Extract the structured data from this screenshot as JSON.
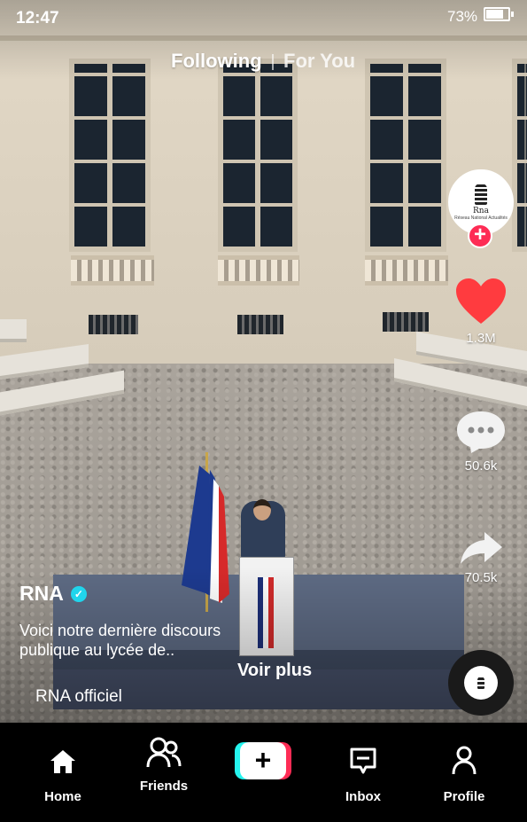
{
  "status_bar": {
    "time": "12:47",
    "battery": "73%"
  },
  "feed_tabs": {
    "following": "Following",
    "for_you": "For You",
    "active": "Following"
  },
  "creator": {
    "avatar_text": "Rna",
    "avatar_subtext": "Réseau National Actualités",
    "username": "RNA",
    "verified": true
  },
  "actions": {
    "likes": "1.3M",
    "comments": "50.6k",
    "shares": "70.5k"
  },
  "caption": {
    "text": "Voici notre dernière discours publique au lycée de..",
    "see_more": "Voir plus",
    "sound": "RNA officiel"
  },
  "colors": {
    "accent_red": "#fe2c55",
    "heart_red": "#ff3b3f",
    "accent_cyan": "#25f4ee",
    "verified_blue": "#20d5ec"
  },
  "nav": {
    "home": "Home",
    "friends": "Friends",
    "inbox": "Inbox",
    "profile": "Profile",
    "active": "Home"
  }
}
